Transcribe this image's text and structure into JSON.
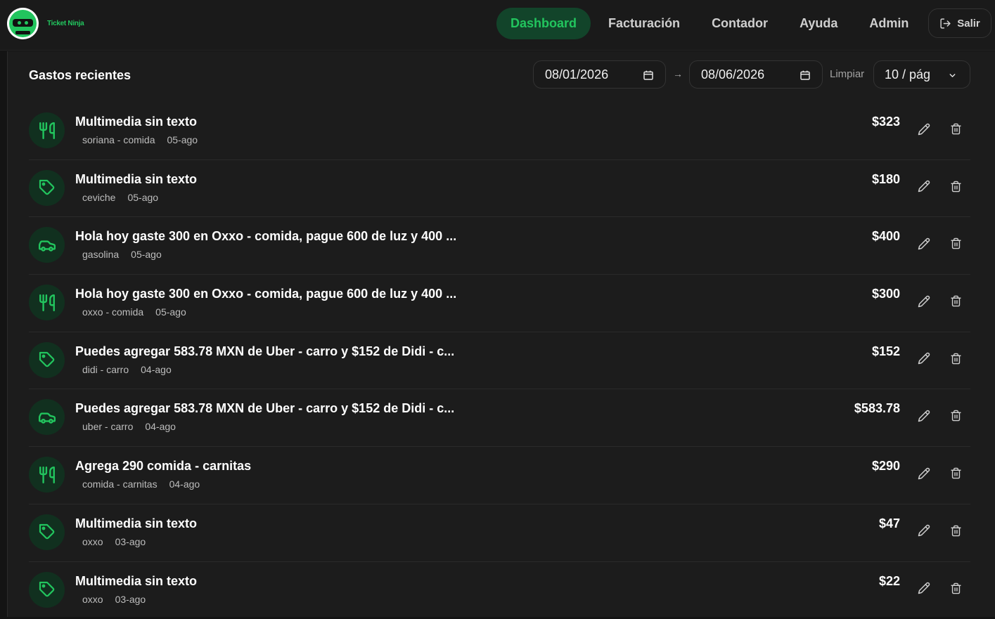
{
  "brand": {
    "name": "Ticket Ninja"
  },
  "nav": {
    "items": [
      {
        "label": "Dashboard",
        "active": true
      },
      {
        "label": "Facturación",
        "active": false
      },
      {
        "label": "Contador",
        "active": false
      },
      {
        "label": "Ayuda",
        "active": false
      },
      {
        "label": "Admin",
        "active": false
      }
    ],
    "logout_label": "Salir"
  },
  "panel": {
    "title": "Gastos recientes",
    "date_from": "08/01/2026",
    "date_arrow": "→",
    "date_to": "08/06/2026",
    "clear_label": "Limpiar",
    "per_page": "10 / pág"
  },
  "expenses": [
    {
      "icon": "utensils-icon",
      "title": "Multimedia sin texto",
      "category": "soriana - comida",
      "date": "05-ago",
      "amount": "$323"
    },
    {
      "icon": "tag-icon",
      "title": "Multimedia sin texto",
      "category": "ceviche",
      "date": "05-ago",
      "amount": "$180"
    },
    {
      "icon": "car-icon",
      "title": "Hola hoy gaste 300 en Oxxo - comida, pague 600 de luz y 400 ...",
      "category": "gasolina",
      "date": "05-ago",
      "amount": "$400"
    },
    {
      "icon": "utensils-icon",
      "title": "Hola hoy gaste 300 en Oxxo - comida, pague 600 de luz y 400 ...",
      "category": "oxxo - comida",
      "date": "05-ago",
      "amount": "$300"
    },
    {
      "icon": "tag-icon",
      "title": "Puedes agregar 583.78 MXN de Uber - carro y $152 de Didi - c...",
      "category": "didi - carro",
      "date": "04-ago",
      "amount": "$152"
    },
    {
      "icon": "car-icon",
      "title": "Puedes agregar 583.78 MXN de Uber - carro y $152 de Didi - c...",
      "category": "uber - carro",
      "date": "04-ago",
      "amount": "$583.78"
    },
    {
      "icon": "utensils-icon",
      "title": "Agrega 290 comida - carnitas",
      "category": "comida - carnitas",
      "date": "04-ago",
      "amount": "$290"
    },
    {
      "icon": "tag-icon",
      "title": "Multimedia sin texto",
      "category": "oxxo",
      "date": "03-ago",
      "amount": "$47"
    },
    {
      "icon": "tag-icon",
      "title": "Multimedia sin texto",
      "category": "oxxo",
      "date": "03-ago",
      "amount": "$22"
    }
  ],
  "colors": {
    "accent": "#22c55e",
    "accent_bg": "#12442a",
    "icon_bg": "#11301f",
    "background": "#141414",
    "panel": "#1c1c1c"
  }
}
